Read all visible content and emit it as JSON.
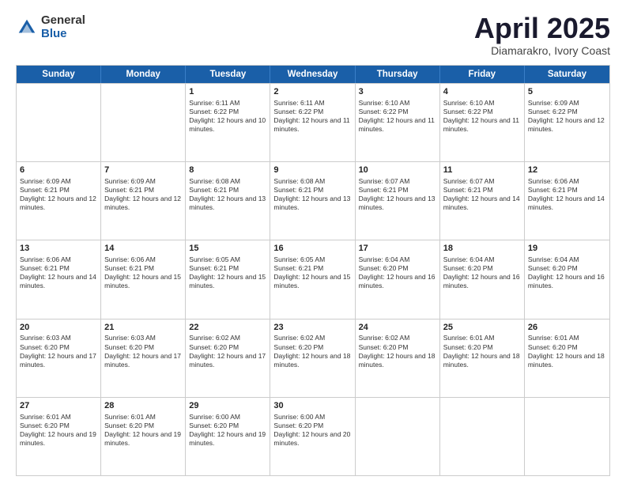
{
  "header": {
    "logo_general": "General",
    "logo_blue": "Blue",
    "title": "April 2025",
    "location": "Diamarakro, Ivory Coast"
  },
  "calendar": {
    "days_of_week": [
      "Sunday",
      "Monday",
      "Tuesday",
      "Wednesday",
      "Thursday",
      "Friday",
      "Saturday"
    ],
    "rows": [
      [
        {
          "day": "",
          "info": ""
        },
        {
          "day": "",
          "info": ""
        },
        {
          "day": "1",
          "info": "Sunrise: 6:11 AM\nSunset: 6:22 PM\nDaylight: 12 hours and 10 minutes."
        },
        {
          "day": "2",
          "info": "Sunrise: 6:11 AM\nSunset: 6:22 PM\nDaylight: 12 hours and 11 minutes."
        },
        {
          "day": "3",
          "info": "Sunrise: 6:10 AM\nSunset: 6:22 PM\nDaylight: 12 hours and 11 minutes."
        },
        {
          "day": "4",
          "info": "Sunrise: 6:10 AM\nSunset: 6:22 PM\nDaylight: 12 hours and 11 minutes."
        },
        {
          "day": "5",
          "info": "Sunrise: 6:09 AM\nSunset: 6:22 PM\nDaylight: 12 hours and 12 minutes."
        }
      ],
      [
        {
          "day": "6",
          "info": "Sunrise: 6:09 AM\nSunset: 6:21 PM\nDaylight: 12 hours and 12 minutes."
        },
        {
          "day": "7",
          "info": "Sunrise: 6:09 AM\nSunset: 6:21 PM\nDaylight: 12 hours and 12 minutes."
        },
        {
          "day": "8",
          "info": "Sunrise: 6:08 AM\nSunset: 6:21 PM\nDaylight: 12 hours and 13 minutes."
        },
        {
          "day": "9",
          "info": "Sunrise: 6:08 AM\nSunset: 6:21 PM\nDaylight: 12 hours and 13 minutes."
        },
        {
          "day": "10",
          "info": "Sunrise: 6:07 AM\nSunset: 6:21 PM\nDaylight: 12 hours and 13 minutes."
        },
        {
          "day": "11",
          "info": "Sunrise: 6:07 AM\nSunset: 6:21 PM\nDaylight: 12 hours and 14 minutes."
        },
        {
          "day": "12",
          "info": "Sunrise: 6:06 AM\nSunset: 6:21 PM\nDaylight: 12 hours and 14 minutes."
        }
      ],
      [
        {
          "day": "13",
          "info": "Sunrise: 6:06 AM\nSunset: 6:21 PM\nDaylight: 12 hours and 14 minutes."
        },
        {
          "day": "14",
          "info": "Sunrise: 6:06 AM\nSunset: 6:21 PM\nDaylight: 12 hours and 15 minutes."
        },
        {
          "day": "15",
          "info": "Sunrise: 6:05 AM\nSunset: 6:21 PM\nDaylight: 12 hours and 15 minutes."
        },
        {
          "day": "16",
          "info": "Sunrise: 6:05 AM\nSunset: 6:21 PM\nDaylight: 12 hours and 15 minutes."
        },
        {
          "day": "17",
          "info": "Sunrise: 6:04 AM\nSunset: 6:20 PM\nDaylight: 12 hours and 16 minutes."
        },
        {
          "day": "18",
          "info": "Sunrise: 6:04 AM\nSunset: 6:20 PM\nDaylight: 12 hours and 16 minutes."
        },
        {
          "day": "19",
          "info": "Sunrise: 6:04 AM\nSunset: 6:20 PM\nDaylight: 12 hours and 16 minutes."
        }
      ],
      [
        {
          "day": "20",
          "info": "Sunrise: 6:03 AM\nSunset: 6:20 PM\nDaylight: 12 hours and 17 minutes."
        },
        {
          "day": "21",
          "info": "Sunrise: 6:03 AM\nSunset: 6:20 PM\nDaylight: 12 hours and 17 minutes."
        },
        {
          "day": "22",
          "info": "Sunrise: 6:02 AM\nSunset: 6:20 PM\nDaylight: 12 hours and 17 minutes."
        },
        {
          "day": "23",
          "info": "Sunrise: 6:02 AM\nSunset: 6:20 PM\nDaylight: 12 hours and 18 minutes."
        },
        {
          "day": "24",
          "info": "Sunrise: 6:02 AM\nSunset: 6:20 PM\nDaylight: 12 hours and 18 minutes."
        },
        {
          "day": "25",
          "info": "Sunrise: 6:01 AM\nSunset: 6:20 PM\nDaylight: 12 hours and 18 minutes."
        },
        {
          "day": "26",
          "info": "Sunrise: 6:01 AM\nSunset: 6:20 PM\nDaylight: 12 hours and 18 minutes."
        }
      ],
      [
        {
          "day": "27",
          "info": "Sunrise: 6:01 AM\nSunset: 6:20 PM\nDaylight: 12 hours and 19 minutes."
        },
        {
          "day": "28",
          "info": "Sunrise: 6:01 AM\nSunset: 6:20 PM\nDaylight: 12 hours and 19 minutes."
        },
        {
          "day": "29",
          "info": "Sunrise: 6:00 AM\nSunset: 6:20 PM\nDaylight: 12 hours and 19 minutes."
        },
        {
          "day": "30",
          "info": "Sunrise: 6:00 AM\nSunset: 6:20 PM\nDaylight: 12 hours and 20 minutes."
        },
        {
          "day": "",
          "info": ""
        },
        {
          "day": "",
          "info": ""
        },
        {
          "day": "",
          "info": ""
        }
      ]
    ]
  }
}
